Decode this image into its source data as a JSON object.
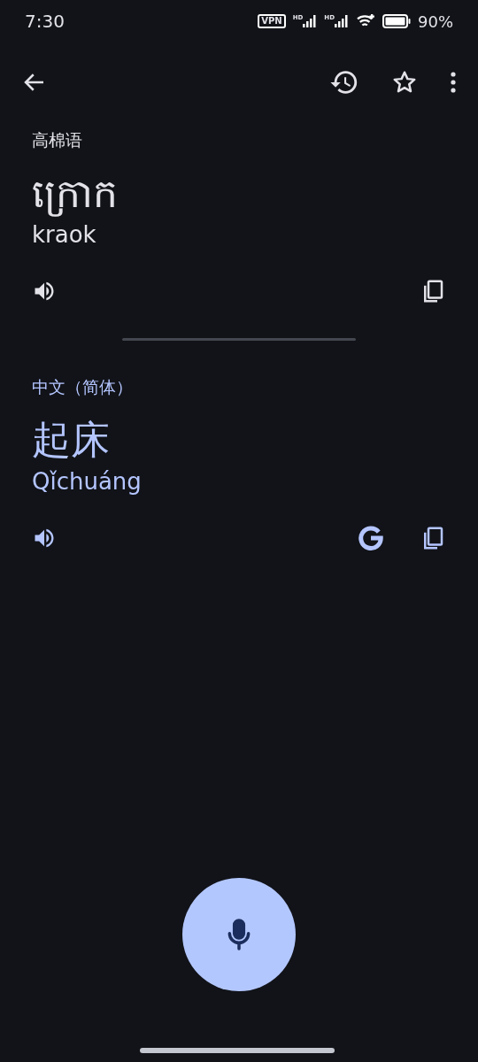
{
  "status_bar": {
    "time": "7:30",
    "vpn": "VPN",
    "signals": [
      {
        "label": "HD"
      },
      {
        "label": "HD"
      }
    ],
    "battery": "90%"
  },
  "sections": [
    {
      "kind": "source",
      "language": "高棉语",
      "text": "ក្រោក",
      "romanization": "kraok"
    },
    {
      "kind": "target",
      "language": "中文（简体）",
      "text": "起床",
      "romanization": "Qǐchuáng"
    }
  ]
}
